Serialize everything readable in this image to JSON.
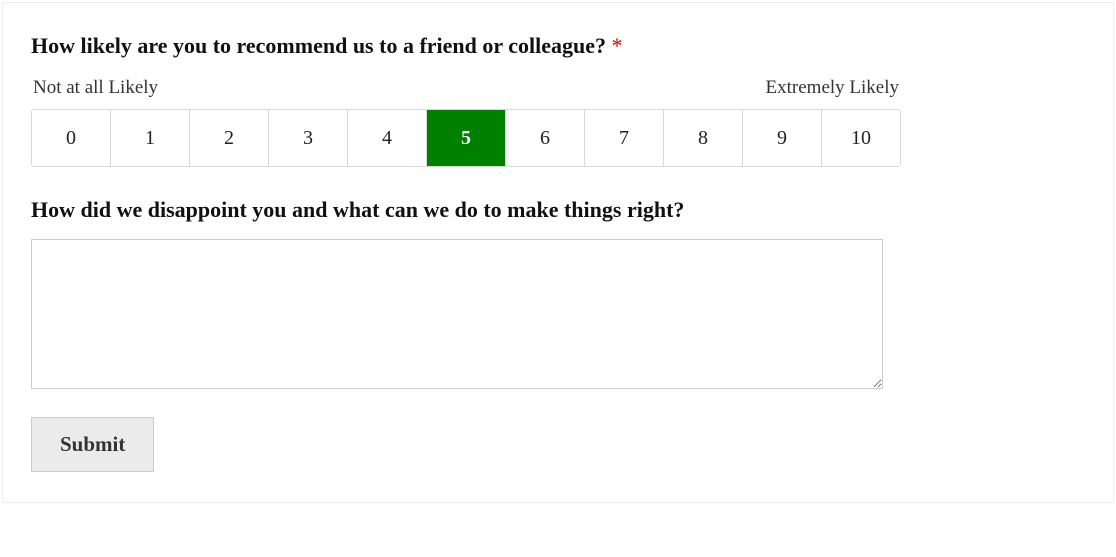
{
  "question1": {
    "text": "How likely are you to recommend us to a friend or colleague?",
    "required_mark": "*",
    "low_label": "Not at all Likely",
    "high_label": "Extremely Likely",
    "options": [
      "0",
      "1",
      "2",
      "3",
      "4",
      "5",
      "6",
      "7",
      "8",
      "9",
      "10"
    ],
    "selected_index": 5
  },
  "question2": {
    "text": "How did we disappoint you and what can we do to make things right?",
    "value": ""
  },
  "submit_label": "Submit"
}
